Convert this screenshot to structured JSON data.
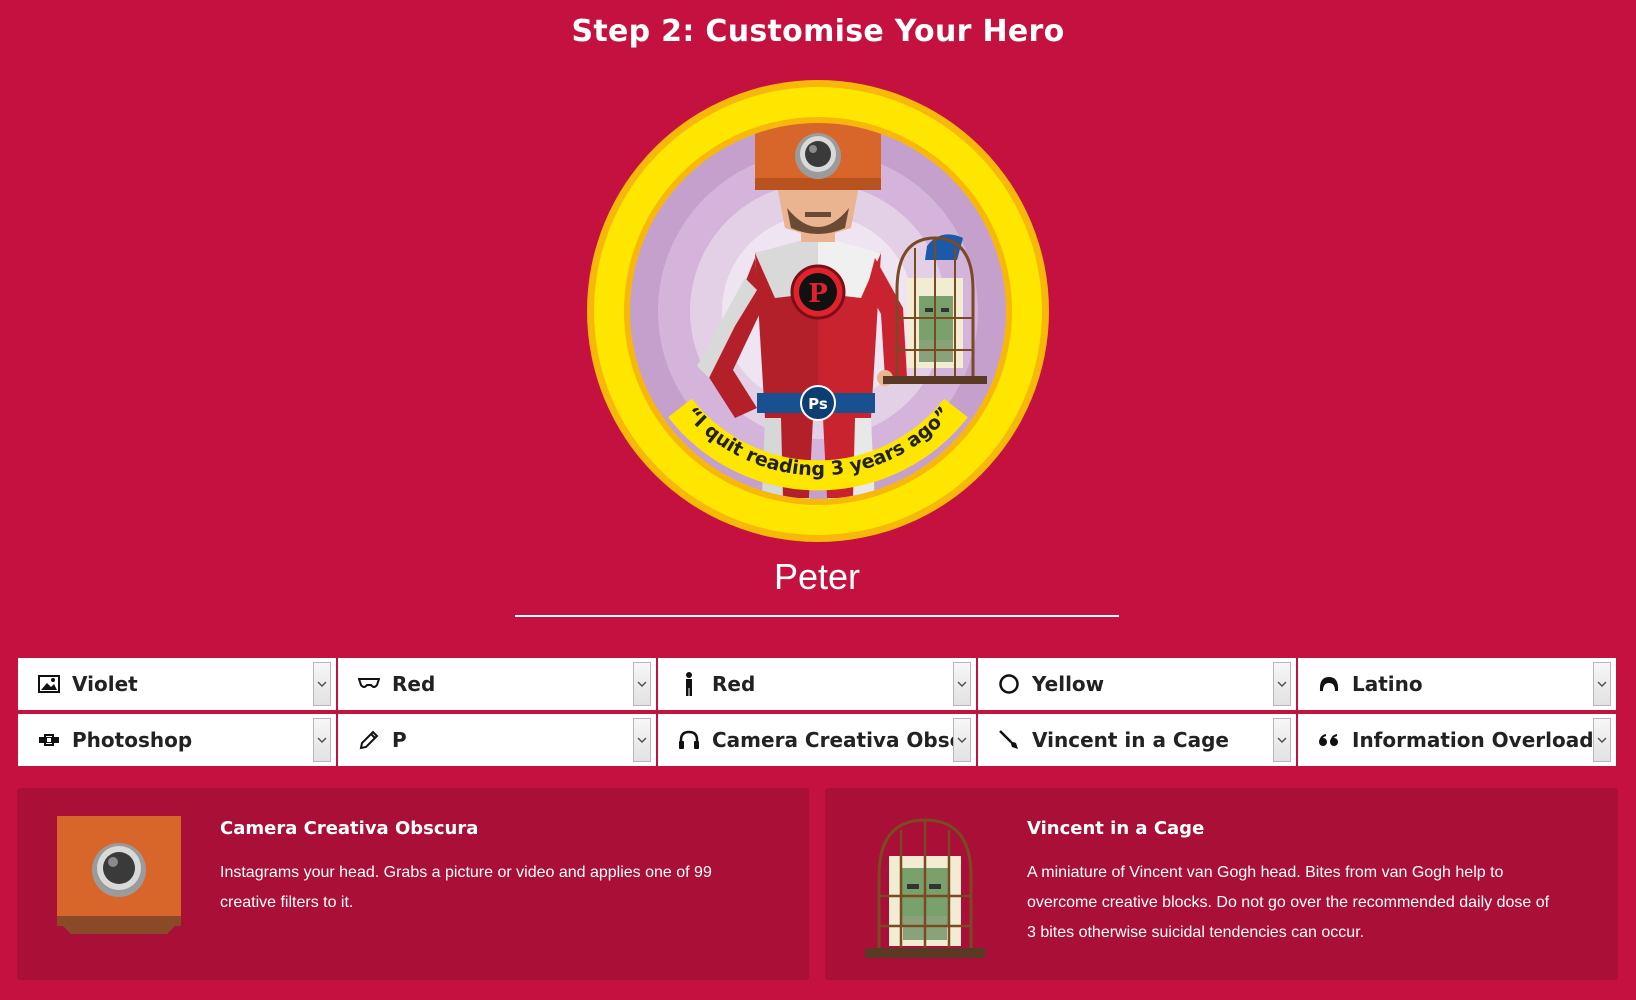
{
  "page": {
    "title": "Step 2: Customise Your Hero"
  },
  "hero": {
    "name": "Peter",
    "quote": "“I quit reading 3 years ago”",
    "chest_letter": "P",
    "belt_label": "Ps"
  },
  "colors": {
    "background": "#c41140",
    "card_background": "#a90f37",
    "badge_outer": "#ffe600",
    "badge_inner": "#c6a0cd"
  },
  "selectors": [
    {
      "icon": "image-icon",
      "value": "Violet"
    },
    {
      "icon": "mask-icon",
      "value": "Red"
    },
    {
      "icon": "figure-icon",
      "value": "Red"
    },
    {
      "icon": "circle-icon",
      "value": "Yellow"
    },
    {
      "icon": "hair-icon",
      "value": "Latino"
    },
    {
      "icon": "belt-icon",
      "value": "Photoshop"
    },
    {
      "icon": "pencil-icon",
      "value": "P"
    },
    {
      "icon": "headphones-icon",
      "value": "Camera Creativa Obscura"
    },
    {
      "icon": "brush-icon",
      "value": "Vincent in a Cage"
    },
    {
      "icon": "quote-icon",
      "value": "Information Overload"
    }
  ],
  "cards": [
    {
      "title": "Camera Creativa Obscura",
      "desc_lines": [
        "Instagrams your head. Grabs a picture or video and applies one of 99",
        "creative filters to it."
      ]
    },
    {
      "title": "Vincent in a Cage",
      "desc_lines": [
        "A miniature of Vincent van Gogh head. Bites from van Gogh help to",
        "overcome creative blocks. Do not go over the recommended daily dose of",
        "3 bites otherwise suicidal tendencies can occur."
      ]
    }
  ]
}
